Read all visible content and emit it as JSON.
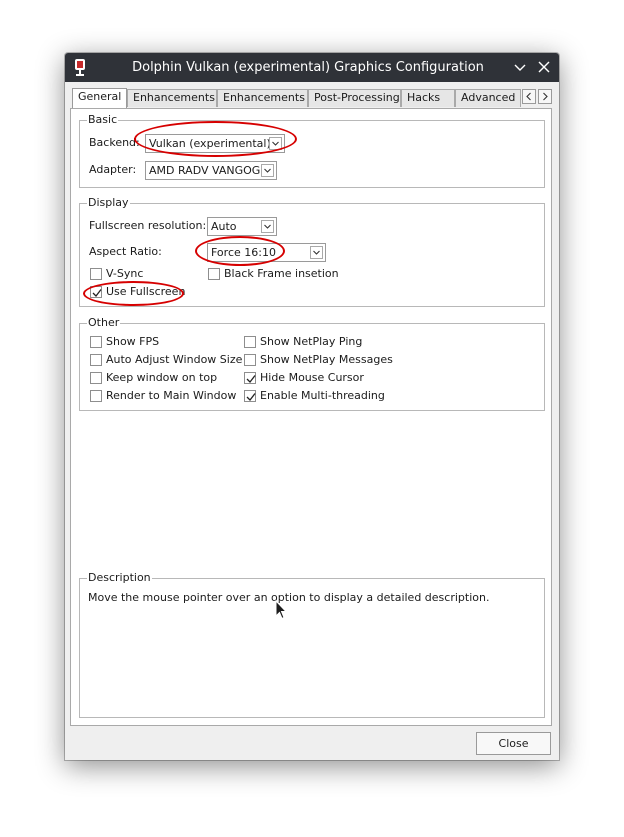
{
  "window": {
    "title": "Dolphin Vulkan (experimental) Graphics Configuration",
    "icons": {
      "app": "dolphin-app-icon",
      "minimize": "chevron-down-icon",
      "close": "close-icon"
    }
  },
  "tabs": [
    {
      "label": "General",
      "active": true
    },
    {
      "label": "Enhancements",
      "active": false
    },
    {
      "label": "Enhancements",
      "active": false
    },
    {
      "label": "Post-Processing",
      "active": false
    },
    {
      "label": "Hacks",
      "active": false
    },
    {
      "label": "Advanced",
      "active": false
    }
  ],
  "tab_scroll": {
    "left": "‹",
    "right": "›"
  },
  "basic": {
    "title": "Basic",
    "backend_label": "Backend:",
    "backend_value": "Vulkan (experimental)",
    "adapter_label": "Adapter:",
    "adapter_value": "AMD RADV VANGOGH"
  },
  "display": {
    "title": "Display",
    "fullscreen_res_label": "Fullscreen resolution:",
    "fullscreen_res_value": "Auto",
    "aspect_label": "Aspect Ratio:",
    "aspect_value": "Force 16:10",
    "vsync": {
      "label": "V-Sync",
      "checked": false
    },
    "black_frame": {
      "label": "Black Frame insetion",
      "checked": false
    },
    "use_fullscreen": {
      "label": "Use Fullscreen",
      "checked": true
    }
  },
  "other": {
    "title": "Other",
    "show_fps": {
      "label": "Show FPS",
      "checked": false
    },
    "auto_adjust": {
      "label": "Auto Adjust Window Size",
      "checked": false
    },
    "keep_on_top": {
      "label": "Keep window on top",
      "checked": false
    },
    "render_main": {
      "label": "Render to Main Window",
      "checked": false
    },
    "netplay_ping": {
      "label": "Show NetPlay Ping",
      "checked": false
    },
    "netplay_msgs": {
      "label": "Show NetPlay Messages",
      "checked": false
    },
    "hide_cursor": {
      "label": "Hide Mouse Cursor",
      "checked": true
    },
    "multithread": {
      "label": "Enable Multi-threading",
      "checked": true
    }
  },
  "description": {
    "title": "Description",
    "text": "Move the mouse pointer over an option to display a detailed description."
  },
  "buttons": {
    "close": "Close"
  },
  "colors": {
    "titlebar": "#2f3238",
    "annotation": "#d60000",
    "window_bg": "#efefef"
  }
}
